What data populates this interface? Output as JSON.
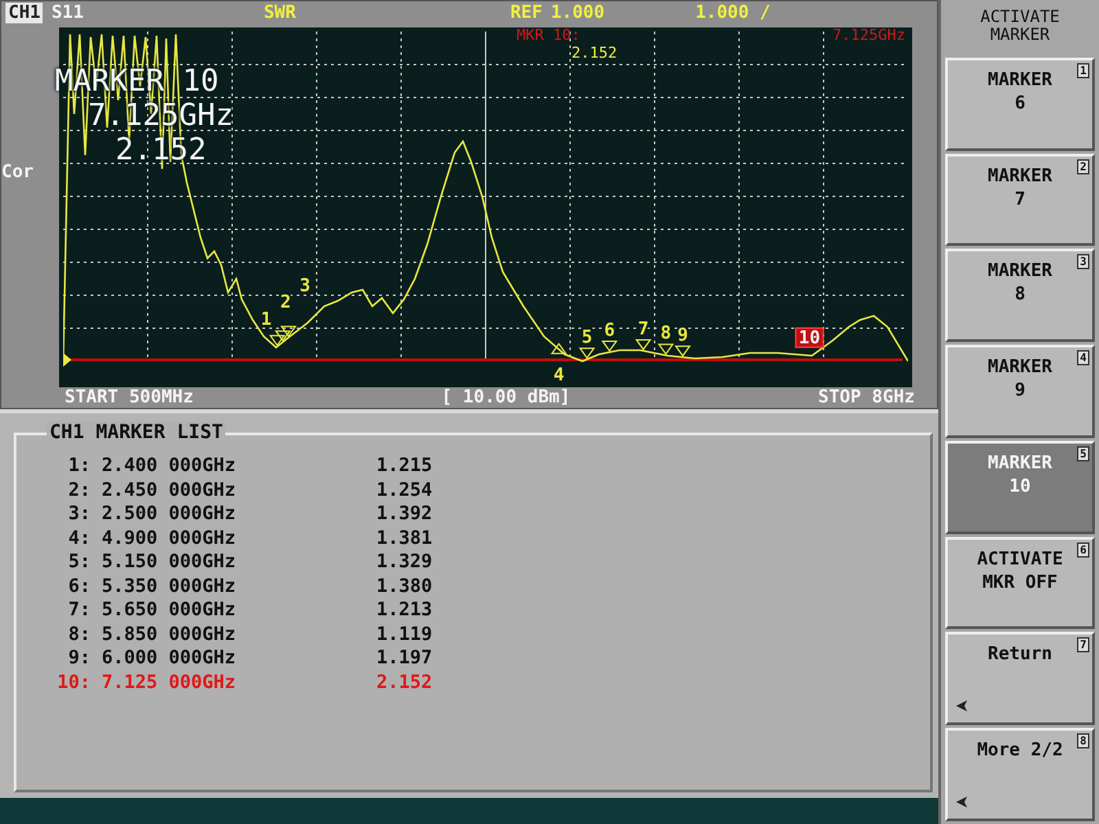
{
  "header": {
    "channel": "CH1",
    "param": "S11",
    "format": "SWR",
    "ref_label": "REF",
    "ref_value": "1.000",
    "scale": "1.000 /"
  },
  "side_label": "Cor",
  "active_marker": {
    "title": "MARKER 10",
    "freq": "7.125GHz",
    "value": "2.152"
  },
  "marker_readout": {
    "label": "MKR 10:",
    "freq": "7.125GHz",
    "value": "2.152"
  },
  "graph_markers": [
    {
      "label": "1",
      "kind": "down",
      "selected": false
    },
    {
      "label": "2",
      "kind": "down",
      "selected": false
    },
    {
      "label": "3",
      "kind": "down",
      "selected": false
    },
    {
      "label": "4",
      "kind": "up",
      "selected": false
    },
    {
      "label": "5",
      "kind": "down",
      "selected": false
    },
    {
      "label": "6",
      "kind": "down",
      "selected": false
    },
    {
      "label": "7",
      "kind": "down",
      "selected": false
    },
    {
      "label": "8",
      "kind": "down",
      "selected": false
    },
    {
      "label": "9",
      "kind": "down",
      "selected": false
    },
    {
      "label": "10",
      "kind": "down",
      "selected": true
    }
  ],
  "footer": {
    "start": "START 500MHz",
    "power": "[ 10.00 dBm]",
    "stop": "STOP 8GHz"
  },
  "marker_list": {
    "title": "CH1 MARKER LIST",
    "rows": [
      {
        "index": "1:",
        "freq": "2.400 000GHz",
        "value": "1.215",
        "selected": false
      },
      {
        "index": "2:",
        "freq": "2.450 000GHz",
        "value": "1.254",
        "selected": false
      },
      {
        "index": "3:",
        "freq": "2.500 000GHz",
        "value": "1.392",
        "selected": false
      },
      {
        "index": "4:",
        "freq": "4.900 000GHz",
        "value": "1.381",
        "selected": false
      },
      {
        "index": "5:",
        "freq": "5.150 000GHz",
        "value": "1.329",
        "selected": false
      },
      {
        "index": "6:",
        "freq": "5.350 000GHz",
        "value": "1.380",
        "selected": false
      },
      {
        "index": "7:",
        "freq": "5.650 000GHz",
        "value": "1.213",
        "selected": false
      },
      {
        "index": "8:",
        "freq": "5.850 000GHz",
        "value": "1.119",
        "selected": false
      },
      {
        "index": "9:",
        "freq": "6.000 000GHz",
        "value": "1.197",
        "selected": false
      },
      {
        "index": "10:",
        "freq": "7.125 000GHz",
        "value": "2.152",
        "selected": true
      }
    ]
  },
  "softkeys": {
    "title": "ACTIVATE MARKER",
    "keys": [
      {
        "lines": [
          "MARKER",
          "6"
        ],
        "number": "1",
        "selected": false,
        "arrow": false
      },
      {
        "lines": [
          "MARKER",
          "7"
        ],
        "number": "2",
        "selected": false,
        "arrow": false
      },
      {
        "lines": [
          "MARKER",
          "8"
        ],
        "number": "3",
        "selected": false,
        "arrow": false
      },
      {
        "lines": [
          "MARKER",
          "9"
        ],
        "number": "4",
        "selected": false,
        "arrow": false
      },
      {
        "lines": [
          "MARKER",
          "10"
        ],
        "number": "5",
        "selected": true,
        "arrow": false
      },
      {
        "lines": [
          "ACTIVATE",
          "MKR OFF"
        ],
        "number": "6",
        "selected": false,
        "arrow": false
      },
      {
        "lines": [
          "Return"
        ],
        "number": "7",
        "selected": false,
        "arrow": true
      },
      {
        "lines": [
          "More 2/2"
        ],
        "number": "8",
        "selected": false,
        "arrow": true
      }
    ]
  }
}
